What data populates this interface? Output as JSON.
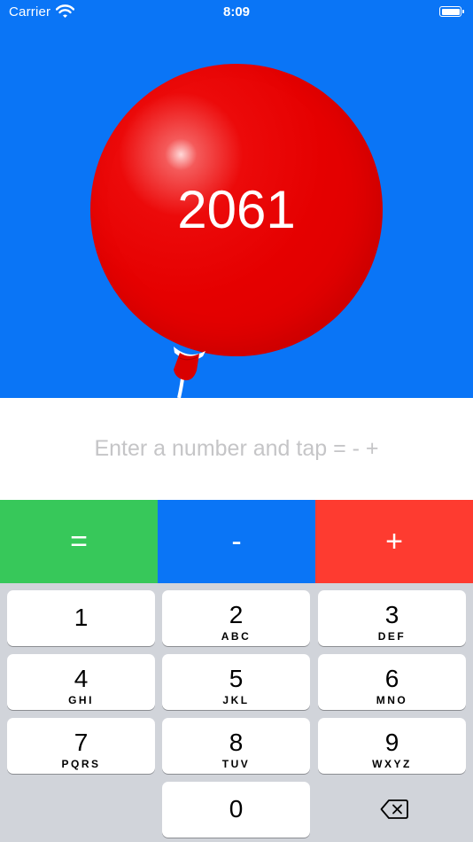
{
  "status_bar": {
    "carrier": "Carrier",
    "time": "8:09"
  },
  "balloon": {
    "value": "2061",
    "color": "#e60000"
  },
  "input": {
    "placeholder": "Enter a number and tap = - +",
    "value": ""
  },
  "operations": [
    {
      "label": "=",
      "color": "#37c85a"
    },
    {
      "label": "-",
      "color": "#0a75f6"
    },
    {
      "label": "+",
      "color": "#fe3b30"
    }
  ],
  "keypad": [
    {
      "digit": "1",
      "letters": ""
    },
    {
      "digit": "2",
      "letters": "ABC"
    },
    {
      "digit": "3",
      "letters": "DEF"
    },
    {
      "digit": "4",
      "letters": "GHI"
    },
    {
      "digit": "5",
      "letters": "JKL"
    },
    {
      "digit": "6",
      "letters": "MNO"
    },
    {
      "digit": "7",
      "letters": "PQRS"
    },
    {
      "digit": "8",
      "letters": "TUV"
    },
    {
      "digit": "9",
      "letters": "WXYZ"
    },
    {
      "digit": "0",
      "letters": ""
    }
  ],
  "colors": {
    "background": "#0a75f6",
    "keyboard": "#d1d4da"
  }
}
